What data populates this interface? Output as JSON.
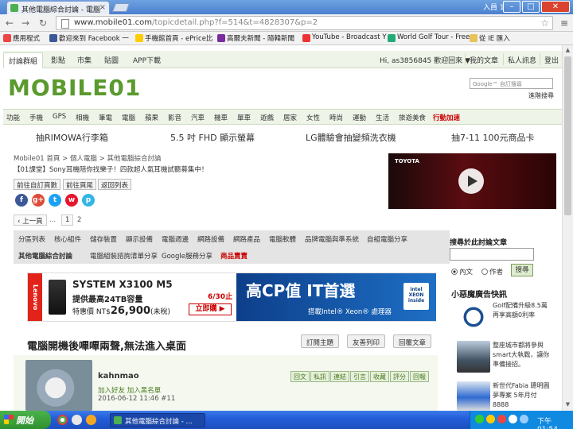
{
  "browser": {
    "tab_title": "其他電腦綜合討論 - 電腦",
    "tab_close": "×",
    "user_badge": "入員 1",
    "minimize": "–",
    "maximize": "□",
    "close": "✕",
    "url_host": "www.mobile01.com",
    "url_path": "/topicdetail.php?f=514&t=4828307&p=2",
    "bookmarks": [
      "應用程式",
      "歡迎來到 Facebook 一",
      "手機館首頁 - ePrice比",
      "高爾夫新聞 - 隨韓新聞",
      "YouTube - Broadcast Y",
      "World Golf Tour - Free",
      "從 IE 匯入"
    ]
  },
  "site": {
    "top_nav": [
      "討論群組",
      "影點",
      "市集",
      "貼圖",
      "APP下載"
    ],
    "user_greeting": "Hi, as3856845 歡迎回來 ▼",
    "user_nav": [
      "我的文章",
      "私人訊息",
      "登出"
    ],
    "logo": "MOBILE01",
    "google_placeholder": "Google™ 自訂搜尋",
    "advanced_search": "進階搜尋",
    "categories": [
      "功能",
      "手機",
      "GPS",
      "相機",
      "筆電",
      "電腦",
      "蘋果",
      "影音",
      "汽車",
      "機車",
      "單車",
      "遊戲",
      "居家",
      "女性",
      "時尚",
      "運動",
      "生活",
      "旅遊美食",
      "行動加速"
    ],
    "promos": [
      "抽RIMOWA行李箱",
      "5.5 吋 FHD 顯示螢幕",
      "LG體驗會抽變頻洗衣機",
      "抽7-11 100元商品卡"
    ]
  },
  "main": {
    "breadcrumb": "Mobile01 首頁 > 個人電腦 > 其他電腦綜合討論",
    "notice": "【01課堂】Sony耳機陪你找樂子！四款超人氣耳機試聽募集中！",
    "actions": [
      "前往自訂頁數",
      "前往頁尾",
      "返回列表"
    ],
    "social": [
      "f",
      "g+",
      "t",
      "w",
      "p"
    ],
    "pager": {
      "prev": "‹ 上一頁",
      "ellipsis": "...",
      "pages": [
        "1",
        "2"
      ]
    },
    "video_brand": "TOYOTA",
    "subcategories_row1": [
      "分區列表",
      "核心組件",
      "儲存裝置",
      "顯示設備",
      "電腦週邊",
      "網路設備",
      "網路產品",
      "電腦軟體",
      "品牌電腦與準系統",
      "自組電腦分享"
    ],
    "subcategories_row2": [
      "其他電腦綜合討論",
      "電腦組裝諮詢清單分享",
      "Google服務分享",
      "商品賣賣"
    ],
    "banner": {
      "brand": "Lenovo",
      "model": "SYSTEM X3100 M5",
      "spec": "提供最高24TB容量",
      "price_label": "特惠價 NT$",
      "price": "26,900",
      "tax": "(未稅)",
      "deadline": "6/30止",
      "buy": "立即購 ▶",
      "slogan": "高CP值 IT首選",
      "processor": "搭載Intel® Xeon® 處理器",
      "chip_label": "intel XEON inside"
    },
    "post_title": "電腦開機後嗶嗶兩聲,無法進入桌面",
    "post_tools": [
      "訂閱主題",
      "友善列印",
      "回覆文章"
    ],
    "post": {
      "username": "kahnmao",
      "user_links": "加入好友  加入黑名單",
      "date": "2016-06-12 11:46  #11",
      "buttons": [
        "回文",
        "私訊",
        "連結",
        "引言",
        "收藏",
        "評分",
        "回報"
      ]
    }
  },
  "sidebar": {
    "search_title": "搜尋於此討論文章",
    "radio_content": "內文",
    "radio_author": "作者",
    "search_button": "搜尋",
    "news_title": "小惡魔廣告快訊",
    "news": [
      "Golf配備升級8.5萬再享高額0利率",
      "整座城市都將參與smart大執戰，讓你準備接招。",
      "新世代Fabia 聰明圓夢專案 5年月付8888"
    ]
  },
  "taskbar": {
    "start": "開始",
    "task": "其他電腦綜合討論 - ...",
    "clock": "下午 01:54"
  }
}
